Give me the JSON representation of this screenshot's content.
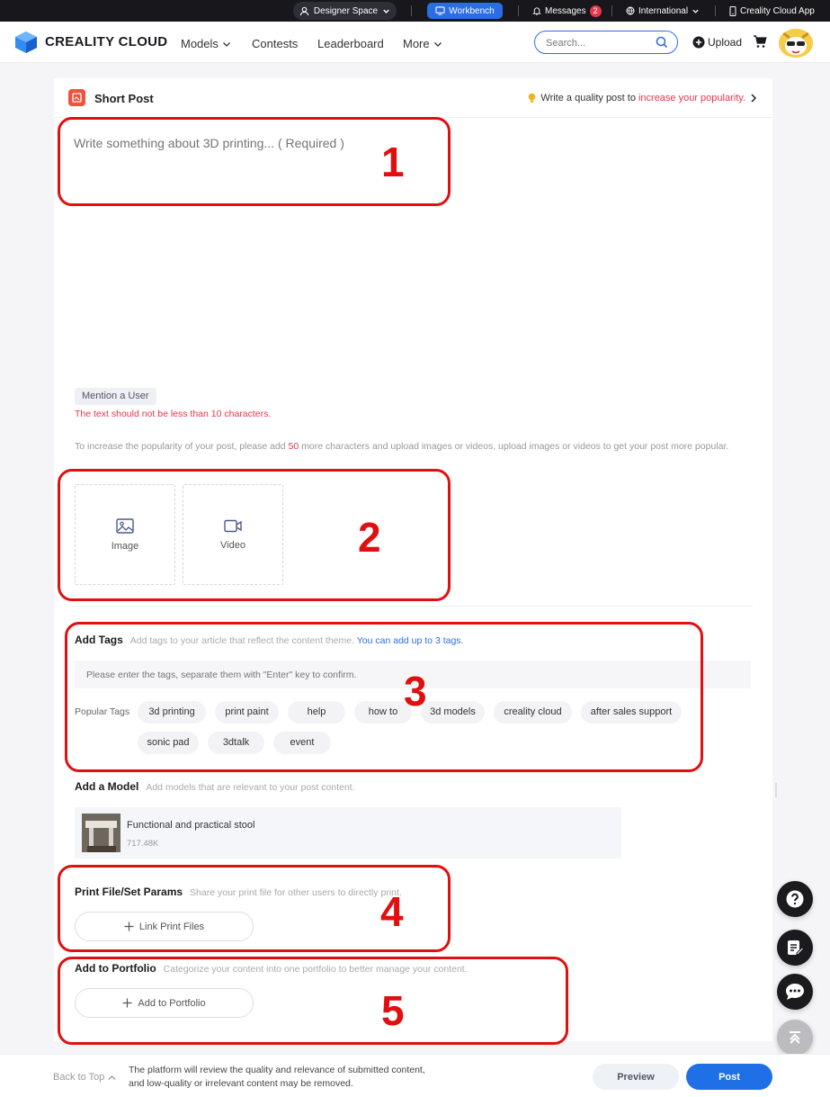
{
  "topbar": {
    "designer_space": "Designer Space",
    "workbench": "Workbench",
    "messages": "Messages",
    "messages_count": "2",
    "region": "International",
    "app": "Creality Cloud App"
  },
  "nav": {
    "logo": "CREALITY CLOUD",
    "links": [
      "Models",
      "Contests",
      "Leaderboard",
      "More"
    ],
    "search_placeholder": "Search...",
    "upload": "Upload"
  },
  "post": {
    "header_title": "Short Post",
    "tip_prefix": "Write a quality post to",
    "tip_highlight": "increase your popularity.",
    "text_placeholder": "Write something about 3D printing... ( Required )",
    "mention": "Mention a User",
    "warning": "The text should not be less than 10 characters.",
    "hint_prefix": "To increase the popularity of your post, please add",
    "hint_count": "50",
    "hint_suffix": "more characters and upload images or videos, upload images or videos to get your post more popular.",
    "image_label": "Image",
    "video_label": "Video"
  },
  "tags": {
    "title": "Add Tags",
    "desc": "Add tags to your article that reflect the content theme.",
    "desc_highlight": "You can add up to 3 tags.",
    "input_placeholder": "Please enter the tags, separate them with \"Enter\" key to confirm.",
    "popular_label": "Popular Tags",
    "popular": [
      "3d printing",
      "print paint",
      "help",
      "how to",
      "3d models",
      "creality cloud",
      "after sales support",
      "sonic pad",
      "3dtalk",
      "event"
    ]
  },
  "model": {
    "title": "Add a Model",
    "desc": "Add models that are relevant to your post content.",
    "item_name": "Functional and practical stool",
    "item_size": "717.48K"
  },
  "print": {
    "title": "Print File/Set Params",
    "desc": "Share your print file for other users to directly print.",
    "button": "Link Print Files"
  },
  "portfolio": {
    "title": "Add to Portfolio",
    "desc": "Categorize your content into one portfolio to better manage your content.",
    "button": "Add to Portfolio"
  },
  "footer": {
    "back_to_top": "Back to Top",
    "notice_line1": "The platform will review the quality and relevance of submitted content,",
    "notice_line2": "and low-quality or irrelevant content may be removed.",
    "preview": "Preview",
    "post": "Post"
  },
  "annotations": [
    "1",
    "2",
    "3",
    "4",
    "5"
  ],
  "colors": {
    "accent_blue": "#1f6fe6",
    "alert_red": "#e8374b",
    "annotation_red": "#e01010",
    "dark_bar": "#17171c"
  },
  "icons": [
    "user-icon",
    "chevron-down-icon",
    "monitor-icon",
    "bell-icon",
    "globe-icon",
    "phone-icon",
    "search-icon",
    "plus-circle-icon",
    "cart-icon",
    "bulb-icon",
    "chevron-right-icon",
    "image-icon",
    "video-icon",
    "plus-icon",
    "help-icon",
    "edit-icon",
    "chat-icon",
    "arrow-up-icon"
  ]
}
